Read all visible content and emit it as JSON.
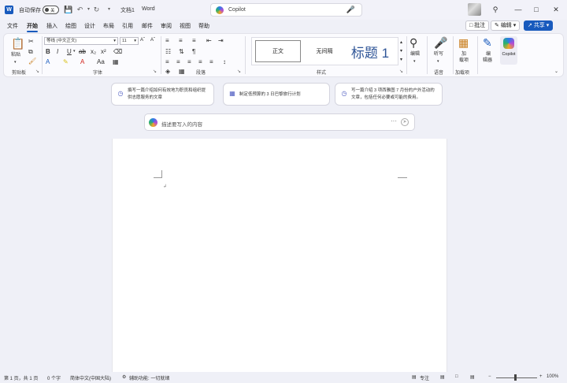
{
  "titlebar": {
    "autosave_label": "自动保存",
    "autosave_state": "关",
    "doc_title": "文档1",
    "app_name": "Word",
    "search_placeholder": "Copilot",
    "window_buttons": [
      "minimize-icon",
      "maximize-icon",
      "close-icon"
    ]
  },
  "tabs": [
    "文件",
    "开始",
    "插入",
    "绘图",
    "设计",
    "布局",
    "引用",
    "邮件",
    "审阅",
    "视图",
    "帮助"
  ],
  "active_tab": "开始",
  "right_buttons": {
    "comments": "批注",
    "editing": "编辑",
    "share": "共享"
  },
  "ribbon": {
    "paste_label": "粘贴",
    "font_name": "等线 (中文正文)",
    "font_size": "11",
    "style_normal": "正文",
    "style_nospacing": "无间隔",
    "style_heading1": "标题 1",
    "dictate_label": "听写",
    "addins_label1": "加",
    "addins_label2": "载项",
    "editor_label1": "编",
    "editor_label2": "辑器",
    "copilot_label": "Copilot",
    "edit_label": "编辑",
    "groups": {
      "clipboard": "剪贴板",
      "font": "字体",
      "paragraph": "段落",
      "styles": "样式",
      "voice": "语音",
      "addins": "加载项"
    }
  },
  "suggestions": [
    {
      "text": "撰写一篇介绍如何有效地为职员和组织提供志愿服务的文章"
    },
    {
      "text": "制定低预算的 3 日巴黎旅行计划"
    },
    {
      "text": "写一篇介绍 3 项西雅图 7 月份的户外活动的文章，包括任何必要或可能的费用。"
    }
  ],
  "prompt": {
    "placeholder": "描述要写入的内容",
    "more": "···"
  },
  "status": {
    "page": "第 1 页，共 1 页",
    "words": "0 个字",
    "language": "简体中文(中国大陆)",
    "accessibility": "辅助功能: 一切就绪",
    "focus": "专注",
    "zoom": "100%"
  },
  "colors": {
    "accent": "#185abd",
    "chrome": "#eff0f7"
  }
}
